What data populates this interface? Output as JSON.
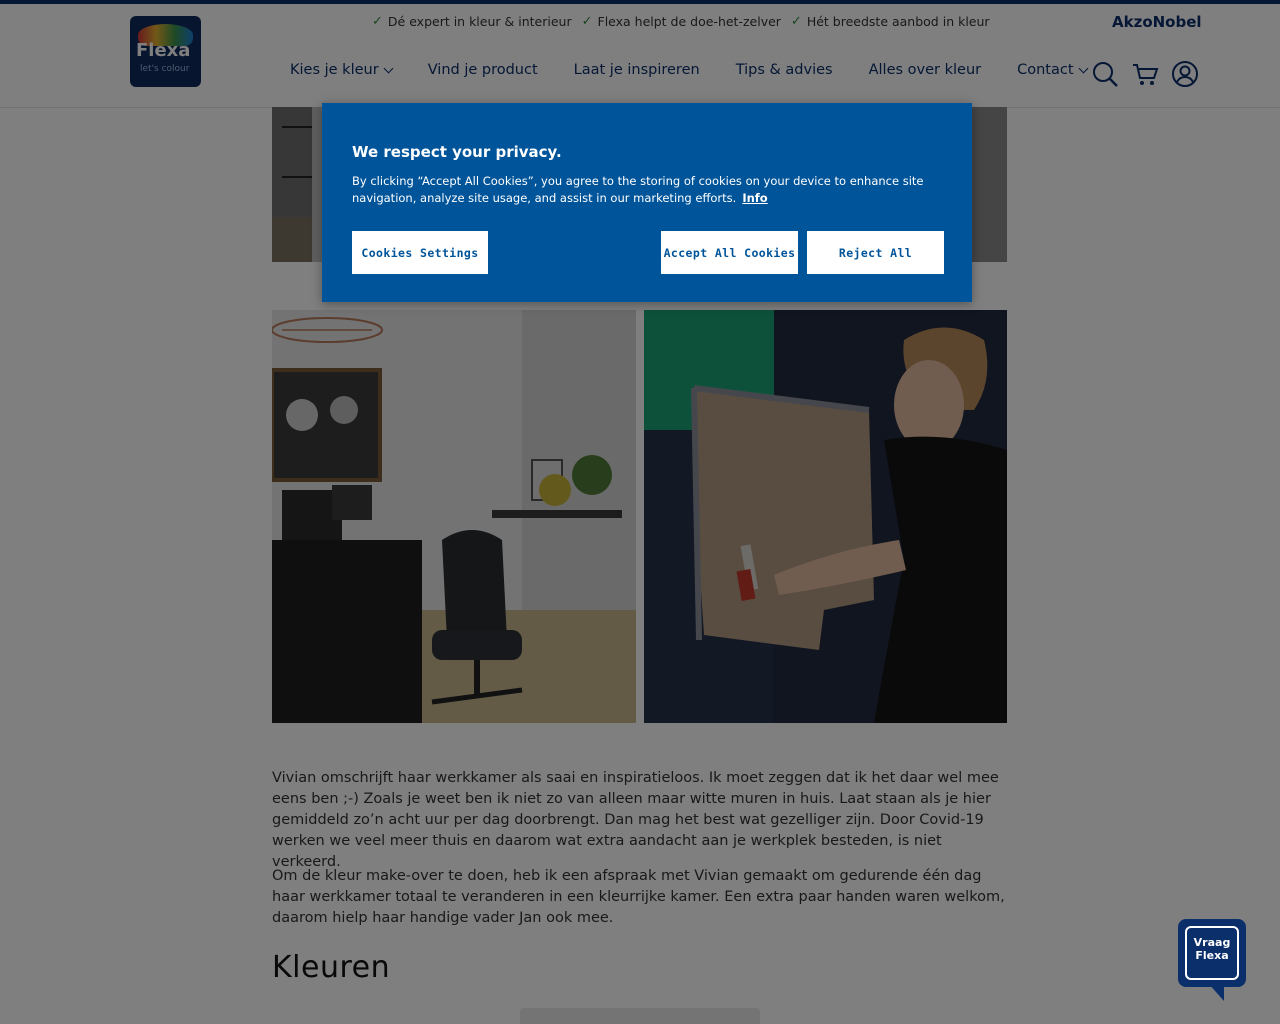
{
  "header": {
    "logo": {
      "name": "Flexa",
      "tagline": "let's colour"
    },
    "usps": [
      "Dé expert in kleur & interieur",
      "Flexa helpt de doe-het-zelver",
      "Hét breedste aanbod in kleur"
    ],
    "brand": "AkzoNobel",
    "nav": [
      {
        "label": "Kies je kleur",
        "dropdown": true
      },
      {
        "label": "Vind je product",
        "dropdown": false
      },
      {
        "label": "Laat je inspireren",
        "dropdown": false
      },
      {
        "label": "Tips & advies",
        "dropdown": false
      },
      {
        "label": "Alles over kleur",
        "dropdown": false
      },
      {
        "label": "Contact",
        "dropdown": true
      }
    ],
    "icons": [
      "search-icon",
      "cart-icon",
      "account-icon"
    ]
  },
  "article": {
    "paragraph1": "Vivian omschrijft haar werkkamer als saai en inspiratieloos. Ik moet zeggen dat ik het daar wel mee eens ben ;-) Zoals je weet ben ik niet zo van alleen maar witte muren in huis. Laat staan als je hier gemiddeld zo’n acht uur per dag doorbrengt. Dan mag het best wat gezelliger zijn. Door Covid-19 werken we veel meer thuis en daarom wat extra aandacht aan je werkplek besteden, is niet verkeerd.",
    "paragraph2": "Om de kleur make-over te doen, heb ik een afspraak met Vivian gemaakt om gedurende één dag haar werkkamer totaal te veranderen in een kleurrijke kamer. Een extra paar handen waren welkom, daarom hielp haar handige vader Jan ook mee.",
    "heading": "Kleuren"
  },
  "cookie_banner": {
    "title": "We respect your privacy.",
    "description": "By clicking “Accept All Cookies”, you agree to the storing of cookies on your device to enhance site navigation, analyze site usage, and assist in our marketing efforts.",
    "info_link": "Info",
    "settings_label": "Cookies Settings",
    "accept_label": "Accept All Cookies",
    "reject_label": "Reject All"
  },
  "chat": {
    "line1": "Vraag",
    "line2": "Flexa"
  },
  "colors": {
    "brand_navy": "#0b2f6b",
    "banner_blue": "#00549a",
    "check_green": "#2e8b3a"
  }
}
